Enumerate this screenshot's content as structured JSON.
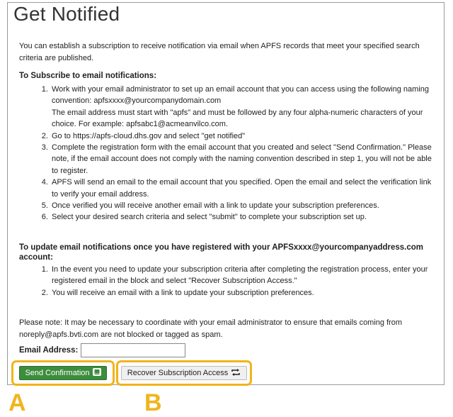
{
  "title": "Get Notified",
  "intro": "You can establish a subscription to receive notification via email when APFS records that meet your specified search criteria are published.",
  "subscribe": {
    "heading": "To Subscribe to email notifications:",
    "steps": [
      "Work with your email administrator to set up an email account that you can access using the following naming convention: apfsxxxx@yourcompanydomain.com\nThe email address must start with \"apfs\" and must be followed by any four alpha-numeric characters of your choice. For example: apfsabc1@acmeanvilco.com.",
      "Go to https://apfs-cloud.dhs.gov and select \"get notified\"",
      "Complete the registration form with the email account that you created and select \"Send Confirmation.\" Please note, if the email account does not comply with the naming convention described in step 1, you will not be able to register.",
      "APFS will send an email to the email account that you specified. Open the email and select the verification link to verify your email address.",
      "Once verified you will receive another email with a link to update your subscription preferences.",
      "Select your desired search criteria and select \"submit\" to complete your subscription set up."
    ]
  },
  "update": {
    "heading": "To update email notifications once you have registered with your APFSxxxx@yourcompanyaddress.com account:",
    "steps": [
      "In the event you need to update your subscription criteria after completing the registration process, enter your registered email in the block and select \"Recover Subscription Access.\"",
      "You will receive an email with a link to update your subscription preferences."
    ]
  },
  "note": "Please note: It may be necessary to coordinate with your email administrator to ensure that emails coming from noreply@apfs.bvti.com are not blocked or tagged as spam.",
  "email": {
    "label": "Email Address:",
    "value": "",
    "placeholder": ""
  },
  "buttons": {
    "send_label": "Send Confirmation",
    "send_icon": "envelope-icon",
    "recover_label": "Recover Subscription Access",
    "recover_icon": "refresh-arrows-icon"
  },
  "markers": {
    "a": "A",
    "b": "B"
  },
  "colors": {
    "highlight": "#f1b41b",
    "green_button": "#3c8d3c"
  }
}
